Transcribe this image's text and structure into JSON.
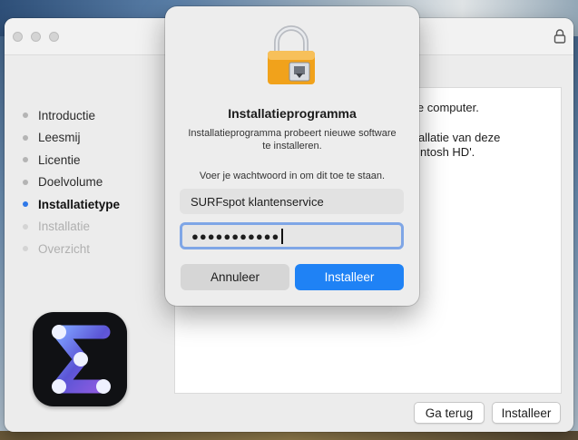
{
  "window": {
    "sidebar_steps": [
      {
        "label": "Introductie",
        "state": "done"
      },
      {
        "label": "Leesmij",
        "state": "done"
      },
      {
        "label": "Licentie",
        "state": "done"
      },
      {
        "label": "Doelvolume",
        "state": "done"
      },
      {
        "label": "Installatietype",
        "state": "current"
      },
      {
        "label": "Installatie",
        "state": "future"
      },
      {
        "label": "Overzicht",
        "state": "future"
      }
    ],
    "content_lines": [
      "je computer.",
      "allatie van deze",
      "ntosh HD'."
    ],
    "back_button": "Ga terug",
    "install_button": "Installeer"
  },
  "dialog": {
    "title": "Installatieprogramma",
    "message": "Installatieprogramma probeert nieuwe software te installeren.",
    "prompt": "Voer je wachtwoord in om dit toe te staan.",
    "username": "SURFspot klantenservice",
    "password_mask": "●●●●●●●●●●●",
    "cancel_button": "Annuleer",
    "ok_button": "Installeer"
  },
  "colors": {
    "accent": "#1f82f5",
    "current_step_dot": "#2f78e8",
    "focus_ring": "#7fa6e6"
  },
  "icons": {
    "titlebar": "lock-icon",
    "dialog": "padlock-icon",
    "app": "sigma-icon"
  }
}
